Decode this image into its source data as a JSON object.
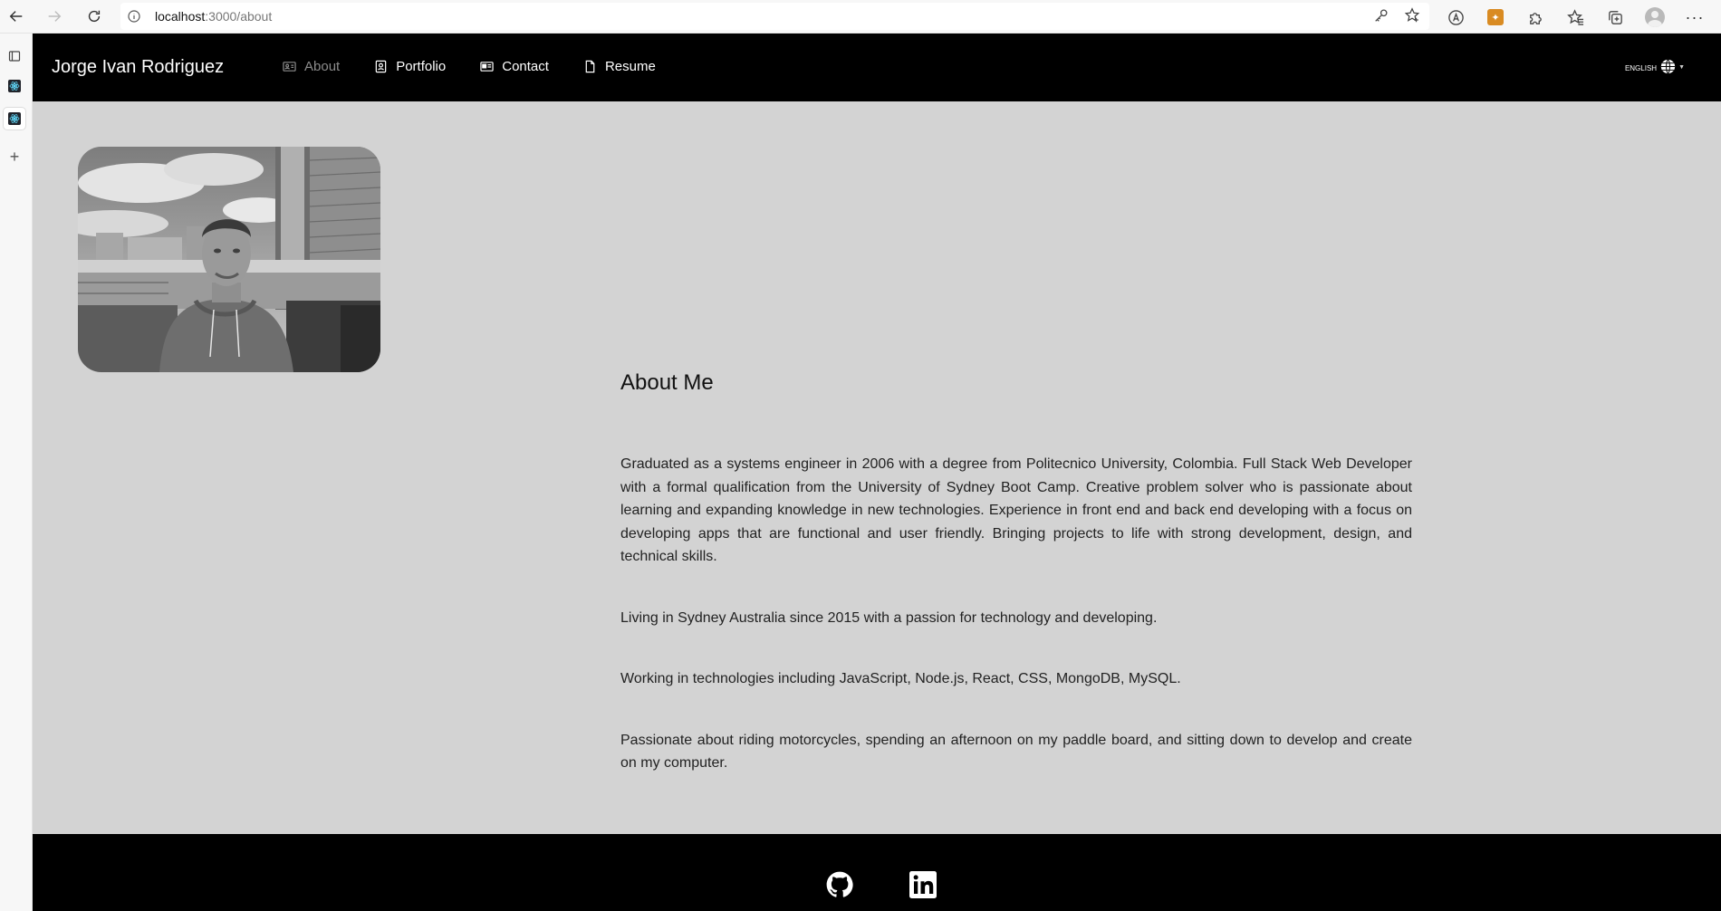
{
  "browser": {
    "url_host": "localhost",
    "url_path": ":3000/about",
    "icons": [
      "back-icon",
      "forward-icon",
      "refresh-icon",
      "info-icon",
      "key-icon",
      "favorite-add-icon",
      "read-aloud-icon",
      "extension-badge-icon",
      "extensions-icon",
      "favorites-icon",
      "collections-icon",
      "profile-avatar",
      "more-icon"
    ]
  },
  "tabs": {
    "icons": [
      "tab-actions-icon",
      "react-tab-icon",
      "react-tab-icon",
      "new-tab-icon"
    ]
  },
  "site": {
    "brand": "Jorge Ivan Rodriguez",
    "nav": [
      {
        "label": "About",
        "icon": "id-card-icon",
        "active": true
      },
      {
        "label": "Portfolio",
        "icon": "portrait-icon",
        "active": false
      },
      {
        "label": "Contact",
        "icon": "contact-card-icon",
        "active": false
      },
      {
        "label": "Resume",
        "icon": "file-icon",
        "active": false
      }
    ],
    "language": {
      "label": "ENGLISH",
      "icon": "globe-icon"
    },
    "colors": {
      "nav_bg": "#000000",
      "page_bg": "#d3d3d3",
      "text": "#222222",
      "active_nav": "#8c8c8c"
    }
  },
  "about": {
    "title": "About Me",
    "paragraphs": [
      "Graduated as a systems engineer in 2006 with a degree from Politecnico University, Colombia. Full Stack Web Developer with a formal qualification from the University of Sydney Boot Camp. Creative problem solver who is passionate about learning and expanding knowledge in new technologies. Experience in front end and back end developing with a focus on developing apps that are functional and user friendly. Bringing projects to life with strong development, design, and technical skills.",
      "Living in Sydney Australia since 2015 with a passion for technology and developing.",
      "Working in technologies including JavaScript, Node.js, React, CSS, MongoDB, MySQL.",
      "Passionate about riding motorcycles, spending an afternoon on my paddle board, and sitting down to develop and create on my computer."
    ]
  },
  "footer": {
    "social": [
      "github-icon",
      "linkedin-icon"
    ]
  }
}
